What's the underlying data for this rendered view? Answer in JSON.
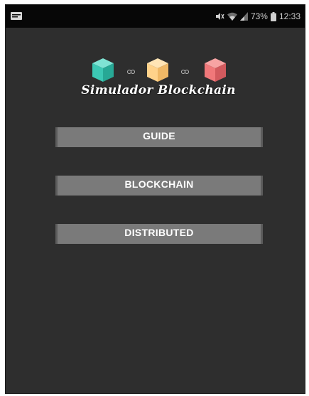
{
  "status_bar": {
    "battery_percent": "73%",
    "time": "12:33",
    "icons": [
      "notification-icon",
      "mute-icon",
      "wifi-icon",
      "signal-icon",
      "battery-icon"
    ]
  },
  "logo": {
    "title": "Simulador Blockchain",
    "cube_colors": [
      "#3cc8b4",
      "#ffd28a",
      "#f0787a"
    ]
  },
  "menu": {
    "guide_label": "GUIDE",
    "blockchain_label": "BLOCKCHAIN",
    "distributed_label": "DISTRIBUTED"
  }
}
